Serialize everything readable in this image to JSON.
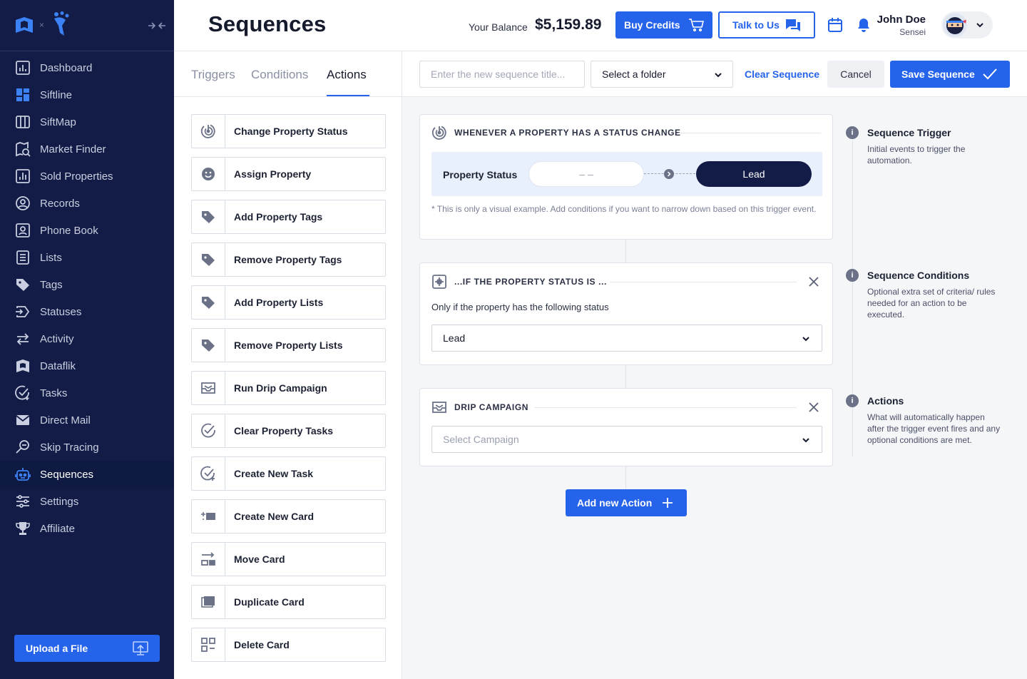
{
  "sidebar": {
    "items": [
      {
        "label": "Dashboard",
        "icon": "dashboard-icon"
      },
      {
        "label": "Siftline",
        "icon": "siftline-icon"
      },
      {
        "label": "SiftMap",
        "icon": "map-icon"
      },
      {
        "label": "Market Finder",
        "icon": "market-finder-icon"
      },
      {
        "label": "Sold Properties",
        "icon": "chart-icon"
      },
      {
        "label": "Records",
        "icon": "records-icon"
      },
      {
        "label": "Phone Book",
        "icon": "phone-book-icon"
      },
      {
        "label": "Lists",
        "icon": "lists-icon"
      },
      {
        "label": "Tags",
        "icon": "tags-icon"
      },
      {
        "label": "Statuses",
        "icon": "statuses-icon"
      },
      {
        "label": "Activity",
        "icon": "activity-icon"
      },
      {
        "label": "Dataflik",
        "icon": "dataflik-icon"
      },
      {
        "label": "Tasks",
        "icon": "tasks-icon"
      },
      {
        "label": "Direct Mail",
        "icon": "mail-icon"
      },
      {
        "label": "Skip Tracing",
        "icon": "skip-tracing-icon"
      },
      {
        "label": "Sequences",
        "icon": "robot-icon",
        "active": true
      },
      {
        "label": "Settings",
        "icon": "settings-icon"
      },
      {
        "label": "Affiliate",
        "icon": "trophy-icon"
      }
    ],
    "upload_label": "Upload a File"
  },
  "header": {
    "title": "Sequences",
    "balance_label": "Your Balance",
    "balance_value": "$5,159.89",
    "buy_credits_label": "Buy Credits",
    "talk_label": "Talk to Us",
    "user_name": "John Doe",
    "user_role": "Sensei"
  },
  "panel": {
    "tabs": [
      "Triggers",
      "Conditions",
      "Actions"
    ],
    "active_tab": "Actions",
    "actions": [
      {
        "label": "Change Property Status",
        "icon": "status-change-icon"
      },
      {
        "label": "Assign Property",
        "icon": "assign-icon"
      },
      {
        "label": "Add Property Tags",
        "icon": "tag-icon"
      },
      {
        "label": "Remove Property Tags",
        "icon": "tag-icon"
      },
      {
        "label": "Add Property Lists",
        "icon": "tag-icon"
      },
      {
        "label": "Remove Property Lists",
        "icon": "tag-icon"
      },
      {
        "label": "Run Drip Campaign",
        "icon": "drip-campaign-icon"
      },
      {
        "label": "Clear Property Tasks",
        "icon": "check-circle-icon"
      },
      {
        "label": "Create New Task",
        "icon": "new-task-icon"
      },
      {
        "label": "Create New Card",
        "icon": "new-card-icon"
      },
      {
        "label": "Move Card",
        "icon": "move-card-icon"
      },
      {
        "label": "Duplicate Card",
        "icon": "duplicate-card-icon"
      },
      {
        "label": "Delete Card",
        "icon": "delete-card-icon"
      }
    ]
  },
  "toolbar": {
    "title_placeholder": "Enter the new sequence title...",
    "folder_label": "Select a folder",
    "clear_label": "Clear Sequence",
    "cancel_label": "Cancel",
    "save_label": "Save Sequence"
  },
  "trigger_card": {
    "heading": "WHENEVER A PROPERTY HAS A STATUS CHANGE",
    "property_status_label": "Property Status",
    "from_value": "– –",
    "to_value": "Lead",
    "note": "* This is only a visual example. Add conditions if you want to narrow down based on this trigger event."
  },
  "condition_card": {
    "heading": "...IF THE PROPERTY STATUS IS ...",
    "description": "Only if the property has the following status",
    "selected_value": "Lead"
  },
  "action_card": {
    "heading": "DRIP CAMPAIGN",
    "placeholder": "Select Campaign"
  },
  "add_action_label": "Add new Action",
  "help": [
    {
      "title": "Sequence Trigger",
      "desc": "Initial events to trigger the automation."
    },
    {
      "title": "Sequence Conditions",
      "desc": "Optional extra set of criteria/ rules needed for an action to be executed."
    },
    {
      "title": "Actions",
      "desc": "What will automatically happen after the trigger event fires and any optional conditions are met."
    }
  ],
  "colors": {
    "accent": "#2563eb",
    "sidebar_bg": "#131c46",
    "lead_pill": "#131c46"
  }
}
